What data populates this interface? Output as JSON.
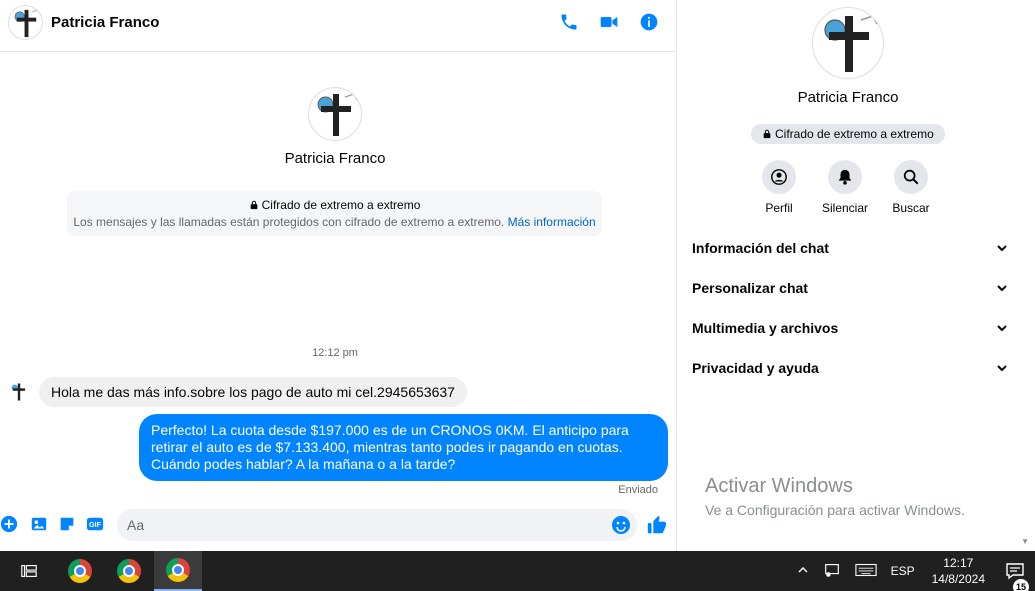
{
  "contact": {
    "name": "Patricia Franco"
  },
  "chat": {
    "e2e_title": "Cifrado de extremo a extremo",
    "e2e_desc": "Los mensajes y las llamadas están protegidos con cifrado de extremo a extremo.",
    "e2e_link": "Más información",
    "timestamp": "12:12 pm",
    "messages": [
      {
        "from": "contact",
        "text": "Hola me das más info.sobre los pago de auto mi cel.2945653637"
      },
      {
        "from": "me",
        "text": "Perfecto! La cuota desde $197.000 es de un CRONOS 0KM. El anticipo para retirar el auto es de $7.133.400, mientras tanto podes ir pagando en cuotas. Cuándo podes hablar? A la mañana o a la tarde?"
      }
    ],
    "sent_status": "Enviado",
    "composer_placeholder": "Aa"
  },
  "info": {
    "e2e_badge": "Cifrado de extremo a extremo",
    "actions": [
      "Perfil",
      "Silenciar",
      "Buscar"
    ],
    "sections": [
      "Información del chat",
      "Personalizar chat",
      "Multimedia y archivos",
      "Privacidad y ayuda"
    ]
  },
  "watermark": {
    "title": "Activar Windows",
    "subtitle": "Ve a Configuración para activar Windows."
  },
  "taskbar": {
    "language": "ESP",
    "time": "12:17",
    "date": "14/8/2024",
    "notifications": "15"
  },
  "colors": {
    "accent": "#0084ff",
    "link": "#0064d1"
  }
}
